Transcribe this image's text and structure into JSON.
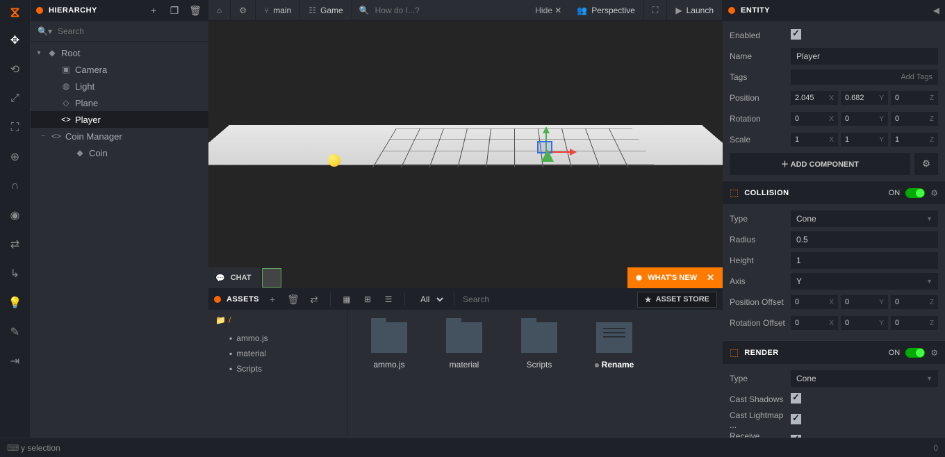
{
  "hierarchy": {
    "title": "HIERARCHY",
    "search_placeholder": "Search",
    "items": {
      "root": "Root",
      "camera": "Camera",
      "light": "Light",
      "plane": "Plane",
      "player": "Player",
      "coin_manager": "Coin Manager",
      "coin": "Coin"
    }
  },
  "toolbar": {
    "main": "main",
    "game": "Game",
    "search_placeholder": "How do I...?",
    "hide": "Hide",
    "perspective": "Perspective",
    "launch": "Launch"
  },
  "chat": {
    "label": "CHAT",
    "whats_new": "WHAT'S NEW"
  },
  "assets": {
    "title": "ASSETS",
    "filter_all": "All",
    "search_placeholder": "Search",
    "store": "ASSET STORE",
    "root": "/",
    "tree": {
      "ammo": "ammo.js",
      "material": "material",
      "scripts": "Scripts"
    },
    "grid": {
      "ammo": "ammo.js",
      "material": "material",
      "scripts": "Scripts",
      "rename": "Rename"
    }
  },
  "inspector": {
    "title": "ENTITY",
    "enabled_label": "Enabled",
    "name_label": "Name",
    "name_value": "Player",
    "tags_label": "Tags",
    "tags_placeholder": "Add Tags",
    "position_label": "Position",
    "position": {
      "x": "2.045",
      "y": "0.682",
      "z": "0"
    },
    "rotation_label": "Rotation",
    "rotation": {
      "x": "0",
      "y": "0",
      "z": "0"
    },
    "scale_label": "Scale",
    "scale": {
      "x": "1",
      "y": "1",
      "z": "1"
    },
    "add_component": "ADD COMPONENT",
    "collision": {
      "title": "COLLISION",
      "on": "ON",
      "type_label": "Type",
      "type_value": "Cone",
      "radius_label": "Radius",
      "radius_value": "0.5",
      "height_label": "Height",
      "height_value": "1",
      "axis_label": "Axis",
      "axis_value": "Y",
      "pos_offset_label": "Position Offset",
      "pos_offset": {
        "x": "0",
        "y": "0",
        "z": "0"
      },
      "rot_offset_label": "Rotation Offset",
      "rot_offset": {
        "x": "0",
        "y": "0",
        "z": "0"
      }
    },
    "render": {
      "title": "RENDER",
      "on": "ON",
      "type_label": "Type",
      "type_value": "Cone",
      "cast_shadows_label": "Cast Shadows",
      "cast_lightmap_label": "Cast Lightmap ...",
      "receive_shadows_label": "Receive Shado..."
    }
  },
  "axes": {
    "x": "X",
    "y": "Y",
    "z": "Z"
  },
  "status": {
    "text": "y selection",
    "count": "0"
  }
}
